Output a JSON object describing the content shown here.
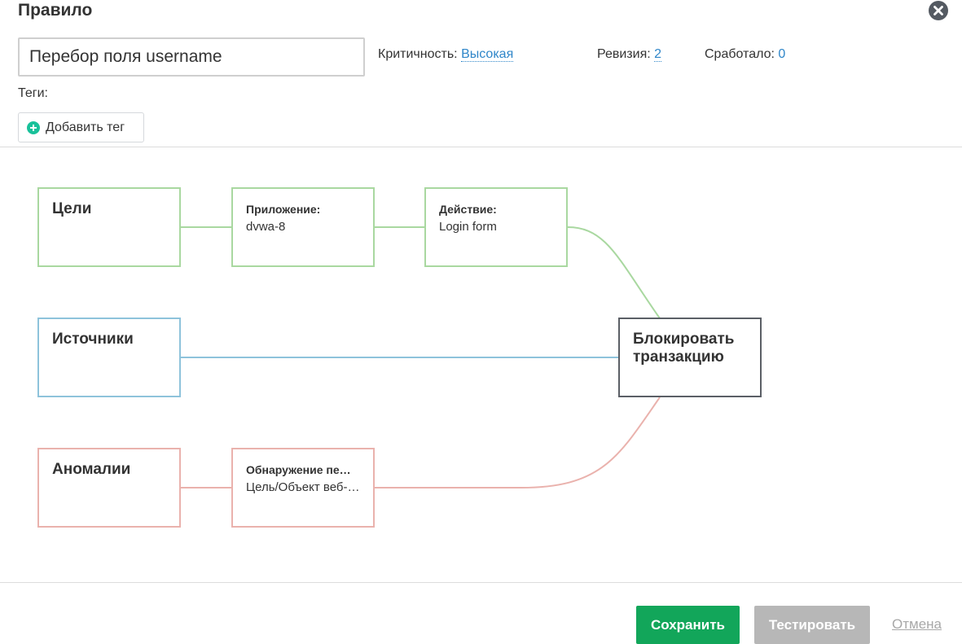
{
  "header": {
    "title": "Правило"
  },
  "rule": {
    "name_value": "Перебор поля username",
    "criticality_label": "Критичность:",
    "criticality_value": "Высокая",
    "revision_label": "Ревизия:",
    "revision_value": "2",
    "triggered_label": "Сработало:",
    "triggered_value": "0"
  },
  "tags": {
    "label": "Теги:",
    "add_label": "Добавить тег"
  },
  "flow": {
    "targets": {
      "label": "Цели",
      "application": {
        "caption": "Приложение:",
        "value": "dvwa-8"
      },
      "action": {
        "caption": "Действие:",
        "value": "Login form"
      }
    },
    "sources": {
      "label": "Источники"
    },
    "anomalies": {
      "label": "Аномалии",
      "detection": {
        "caption": "Обнаружение пе…",
        "value": "Цель/Объект веб-…"
      }
    },
    "result": {
      "label": "Блокировать транзакцию"
    }
  },
  "footer": {
    "save_label": "Сохранить",
    "test_label": "Тестировать",
    "cancel_label": "Отмена"
  },
  "colors": {
    "targets": "#a9d8a0",
    "sources": "#8ec3db",
    "anomalies": "#eab2ad",
    "result": "#5b5f66",
    "save": "#12a65a",
    "test": "#b7b7b7",
    "link": "#2f86c9",
    "add_icon": "#19c19a"
  },
  "icons": {
    "close": "close-circle-icon",
    "add_tag": "plus-circle-icon"
  }
}
